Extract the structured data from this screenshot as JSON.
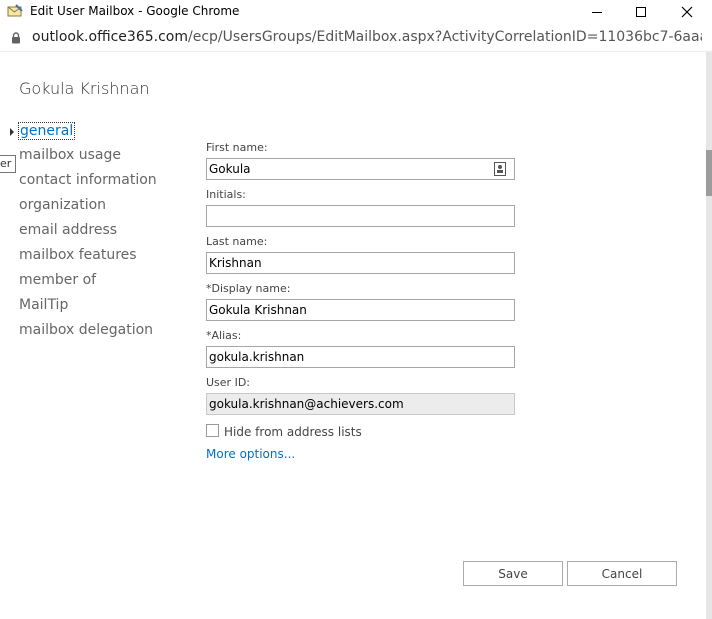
{
  "window": {
    "title": "Edit User Mailbox - Google Chrome"
  },
  "address_bar": {
    "url_host": "outlook.office365.com",
    "url_path": "/ecp/UsersGroups/EditMailbox.aspx?ActivityCorrelationID=11036bc7-6aaa-30aa-d..."
  },
  "header": {
    "user_name": "Gokula Krishnan"
  },
  "tooltip_fragment": "er",
  "nav": {
    "items": [
      {
        "label": "general",
        "active": true
      },
      {
        "label": "mailbox usage"
      },
      {
        "label": "contact information"
      },
      {
        "label": "organization"
      },
      {
        "label": "email address"
      },
      {
        "label": "mailbox features"
      },
      {
        "label": "member of"
      },
      {
        "label": "MailTip"
      },
      {
        "label": "mailbox delegation"
      }
    ]
  },
  "form": {
    "first_name": {
      "label": "First name:",
      "value": "Gokula"
    },
    "initials": {
      "label": "Initials:",
      "value": ""
    },
    "last_name": {
      "label": "Last name:",
      "value": "Krishnan"
    },
    "display_name": {
      "label": "*Display name:",
      "value": "Gokula Krishnan"
    },
    "alias": {
      "label": "*Alias:",
      "value": "gokula.krishnan"
    },
    "user_id": {
      "label": "User ID:",
      "value": "gokula.krishnan@achievers.com"
    },
    "hide_from_address_lists": {
      "label": "Hide from address lists",
      "checked": false
    },
    "more_options": "More options..."
  },
  "buttons": {
    "save": "Save",
    "cancel": "Cancel"
  },
  "colors": {
    "accent": "#0072c6",
    "readonly_bg": "#ececec"
  }
}
